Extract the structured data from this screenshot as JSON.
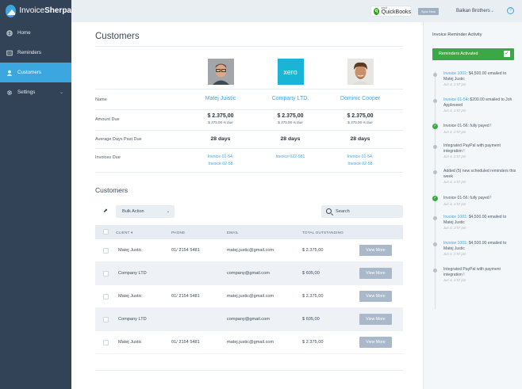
{
  "app": {
    "logo_prefix": "Invoice",
    "logo_suffix": "Sherpa"
  },
  "sidebar": {
    "items": [
      {
        "label": "Home",
        "icon": "globe-icon"
      },
      {
        "label": "Reminders",
        "icon": "reminder-icon"
      },
      {
        "label": "Customers",
        "icon": "user-icon",
        "active": true
      },
      {
        "label": "Settings",
        "icon": "gear-icon"
      }
    ]
  },
  "topbar": {
    "qb_intuit": "intuit",
    "qb_label": "QuickBooks",
    "sync_label": "Sync Now",
    "company": "Balkan Brothers",
    "help": "?"
  },
  "main": {
    "title": "Customers",
    "row_labels": {
      "name": "Name",
      "amount_due": "Amount Due",
      "avg_days": "Average Days Past Due",
      "invoices_due": "Invoices Due"
    },
    "top_customers": [
      {
        "name": "Matej Juistic",
        "amount": "$ 2.375,00",
        "amount_sub": "$ 375.00 is due",
        "days": "28 days",
        "invoices": [
          "Invoice 01-54,",
          "Invoice 02-58"
        ],
        "avatar": "man-glasses-avatar"
      },
      {
        "name": "Company LTD.",
        "amount": "$ 2.375,00",
        "amount_sub": "$ 375.00 is due",
        "days": "28 days",
        "invoices": [
          "Invoice 022-581"
        ],
        "avatar": "xero-logo",
        "logo_text": "xero"
      },
      {
        "name": "Dominic Cooper",
        "amount": "$ 2.375,00",
        "amount_sub": "$ 375.00 is due",
        "days": "28 days",
        "invoices": [
          "Invoice 01-54,",
          "Invoice 02-58"
        ],
        "avatar": "man-curly-avatar"
      }
    ],
    "section_title": "Customers",
    "bulk_action": "Bulk Action",
    "search_placeholder": "Search",
    "columns": {
      "client": "CLIENT",
      "phone": "PHONE",
      "email": "EMAIL",
      "total": "TOTAL OUTSTANDING"
    },
    "rows": [
      {
        "client": "Matej Justic",
        "phone": "01/ 2154 5481",
        "email": "matej.justic@gmail.com",
        "total": "$ 2.375,00",
        "action": "View More"
      },
      {
        "client": "Company LTD",
        "phone": "",
        "email": "company@gmail.com",
        "total": "$ 605,00",
        "action": "View More"
      },
      {
        "client": "Matej Justic",
        "phone": "01/ 2154 5481",
        "email": "matej.justic@gmail.com",
        "total": "$ 2.375,00",
        "action": "View More"
      },
      {
        "client": "Company LTD",
        "phone": "",
        "email": "company@gmail.com",
        "total": "$ 605,00",
        "action": "View More"
      },
      {
        "client": "Matej Justic",
        "phone": "01/ 2154 5481",
        "email": "matej.justic@gmail.com",
        "total": "$ 2.375,00",
        "action": "View More"
      }
    ]
  },
  "activity": {
    "title": "Invoice Reminder Activity",
    "button": "Reminders Activated",
    "items": [
      {
        "link": "Invoice 1001",
        "text": ": $4,500.00 emailed to Matej Justic",
        "date": "Jun 4, 2:57 pm",
        "ok": false
      },
      {
        "link": "Invoice 01-54",
        "text": ": $200.00 emailed to Joh Appleseed",
        "date": "Jun 4, 2:57 pm",
        "ok": false
      },
      {
        "link": "",
        "text": "Invoice 01-56: fully payed !",
        "date": "Jun 4, 2:57 pm",
        "ok": true
      },
      {
        "link": "",
        "text": "Integrated PayPal with payment integration !",
        "date": "Jun 4, 2:57 pm",
        "ok": false
      },
      {
        "link": "",
        "text": "Added (5) new scheduled reminders this week",
        "date": "Jun 4, 2:57 pm",
        "ok": false
      },
      {
        "link": "",
        "text": "Invoice 01-56: fully payed !",
        "date": "Jun 4, 2:57 pm",
        "ok": true
      },
      {
        "link": "Invoice 1001",
        "text": ": $4,500.00 emailed to Matej Justic",
        "date": "Jun 4, 2:57 pm",
        "ok": false
      },
      {
        "link": "Invoice 1001",
        "text": ": $4,500.00 emailed to Matej Justic",
        "date": "Jun 4, 2:57 pm",
        "ok": false
      },
      {
        "link": "",
        "text": "Integrated PayPal with payment integration !",
        "date": "Jun 4, 2:57 pm",
        "ok": false
      }
    ]
  },
  "colors": {
    "accent": "#3ba6df",
    "sidebar": "#324357",
    "success": "#3aa844"
  }
}
